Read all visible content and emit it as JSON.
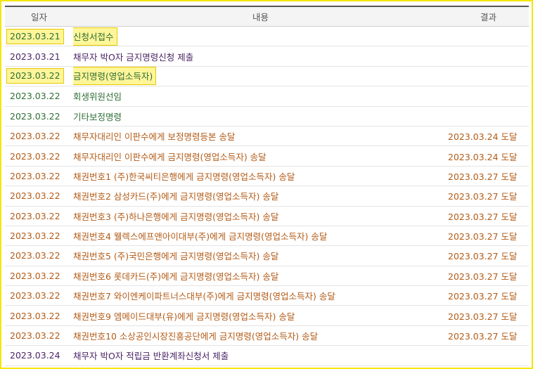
{
  "columns": {
    "date": "일자",
    "content": "내용",
    "result": "결과"
  },
  "colors": {
    "green": "#2e6d34",
    "orange": "#b35b16",
    "purple": "#4a2466",
    "highlight": "#fff69a",
    "frame": "#f5e600"
  },
  "rows": [
    {
      "date": "2023.03.21",
      "content": "신청서접수",
      "result": "",
      "color": "green",
      "highlight": true
    },
    {
      "date": "2023.03.21",
      "content": "채무자 박O자 금지명령신청 제출",
      "result": "",
      "color": "purple",
      "highlight": false
    },
    {
      "date": "2023.03.22",
      "content": "금지명령(영업소득자)",
      "result": "",
      "color": "green",
      "highlight": true
    },
    {
      "date": "2023.03.22",
      "content": "회생위원선임",
      "result": "",
      "color": "green",
      "highlight": false
    },
    {
      "date": "2023.03.22",
      "content": "기타보정명령",
      "result": "",
      "color": "green",
      "highlight": false
    },
    {
      "date": "2023.03.22",
      "content": "채무자대리인 이판수에게 보정명령등본 송달",
      "result": "2023.03.24 도달",
      "color": "orange",
      "highlight": false
    },
    {
      "date": "2023.03.22",
      "content": "채무자대리인 이판수에게 금지명령(영업소득자) 송달",
      "result": "2023.03.24 도달",
      "color": "orange",
      "highlight": false
    },
    {
      "date": "2023.03.22",
      "content": "채권번호1 (주)한국씨티은행에게 금지명령(영업소득자) 송달",
      "result": "2023.03.27 도달",
      "color": "orange",
      "highlight": false
    },
    {
      "date": "2023.03.22",
      "content": "채권번호2 삼성카드(주)에게 금지명령(영업소득자) 송달",
      "result": "2023.03.27 도달",
      "color": "orange",
      "highlight": false
    },
    {
      "date": "2023.03.22",
      "content": "채권번호3 (주)하나은행에게 금지명령(영업소득자) 송달",
      "result": "2023.03.27 도달",
      "color": "orange",
      "highlight": false
    },
    {
      "date": "2023.03.22",
      "content": "채권번호4 웰렉스에프앤아이대부(주)에게 금지명령(영업소득자) 송달",
      "result": "2023.03.27 도달",
      "color": "orange",
      "highlight": false
    },
    {
      "date": "2023.03.22",
      "content": "채권번호5 (주)국민은행에게 금지명령(영업소득자) 송달",
      "result": "2023.03.27 도달",
      "color": "orange",
      "highlight": false
    },
    {
      "date": "2023.03.22",
      "content": "채권번호6 롯데카드(주)에게 금지명령(영업소득자) 송달",
      "result": "2023.03.27 도달",
      "color": "orange",
      "highlight": false
    },
    {
      "date": "2023.03.22",
      "content": "채권번호7 와이엔케이파트너스대부(주)에게 금지명령(영업소득자) 송달",
      "result": "2023.03.27 도달",
      "color": "orange",
      "highlight": false
    },
    {
      "date": "2023.03.22",
      "content": "채권번호9 엠메이드대부(유)에게 금지명령(영업소득자) 송달",
      "result": "2023.03.27 도달",
      "color": "orange",
      "highlight": false
    },
    {
      "date": "2023.03.22",
      "content": "채권번호10 소상공인시장진흥공단에게 금지명령(영업소득자) 송달",
      "result": "2023.03.27 도달",
      "color": "orange",
      "highlight": false
    },
    {
      "date": "2023.03.24",
      "content": "채무자 박O자 적립금 반환계좌신청서 제출",
      "result": "",
      "color": "purple",
      "highlight": false
    }
  ]
}
